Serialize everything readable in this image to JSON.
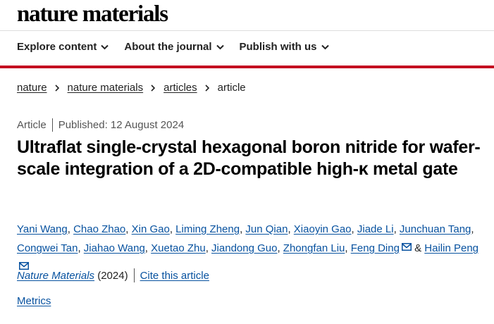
{
  "header": {
    "logo": "nature materials"
  },
  "nav": {
    "items": [
      {
        "label": "Explore content"
      },
      {
        "label": "About the journal"
      },
      {
        "label": "Publish with us"
      }
    ]
  },
  "breadcrumb": {
    "items": [
      "nature",
      "nature materials",
      "articles"
    ],
    "current": "article"
  },
  "article": {
    "type": "Article",
    "published": "Published: 12 August 2024",
    "title": "Ultraflat single-crystal hexagonal boron nitride for wafer-scale integration of a 2D-compatible high-κ metal gate",
    "authors": [
      "Yani Wang",
      "Chao Zhao",
      "Xin Gao",
      "Liming Zheng",
      "Jun Qian",
      "Xiaoyin Gao",
      "Jiade Li",
      "Junchuan Tang",
      "Congwei Tan",
      "Jiahao Wang",
      "Xuetao Zhu",
      "Jiandong Guo",
      "Zhongfan Liu",
      "Feng Ding",
      "Hailin Peng"
    ],
    "author_joiner": "&",
    "journal": "Nature Materials",
    "year": "(2024)",
    "cite_label": "Cite this article",
    "metrics_label": "Metrics"
  },
  "colors": {
    "accent_red": "#c40d20",
    "link_blue": "#06519f"
  },
  "icons": {
    "nav_dropdown": "chevron-down-icon",
    "breadcrumb_sep": "chevron-right-icon",
    "corresponding": "mail-icon"
  }
}
